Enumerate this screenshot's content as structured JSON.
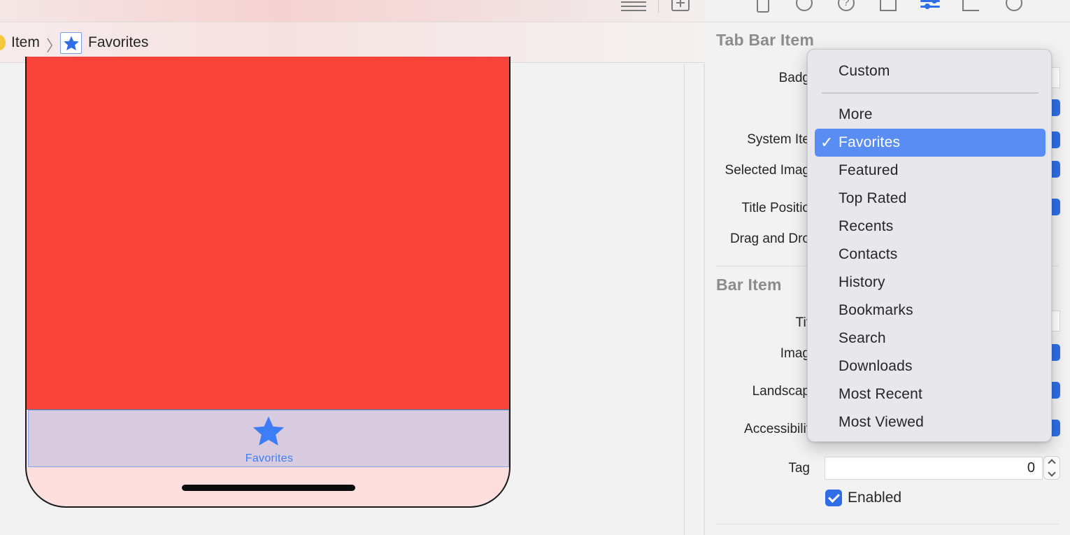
{
  "breadcrumb": {
    "item_label": "Item",
    "separator": "〉",
    "current_label": "Favorites",
    "current_icon": "star-icon"
  },
  "canvas": {
    "tab_bar_label": "Favorites",
    "tab_icon": "star-icon",
    "colors": {
      "view_background": "#f8433a",
      "tab_bar": "#d8cbe0",
      "accent": "#3d7ef6"
    }
  },
  "inspector": {
    "sections": {
      "tab_bar_item": "Tab Bar Item",
      "bar_item": "Bar Item"
    },
    "labels": {
      "badge": "Badg",
      "system_item": "System Ite",
      "selected_image": "Selected Imag",
      "title_position": "Title Positio",
      "drag_and_drop": "Drag and Dro",
      "title": "Tit",
      "image": "Imag",
      "landscape": "Landscap",
      "accessibility": "Accessibilit",
      "tag": "Tag"
    },
    "tag_value": "0",
    "enabled_label": "Enabled",
    "enabled_checked": true,
    "accent_color": "#2f6ee6"
  },
  "menu": {
    "header_item": "Custom",
    "check_mark": "✓",
    "selected": "Favorites",
    "items": [
      "More",
      "Favorites",
      "Featured",
      "Top Rated",
      "Recents",
      "Contacts",
      "History",
      "Bookmarks",
      "Search",
      "Downloads",
      "Most Recent",
      "Most Viewed"
    ],
    "highlight_color": "#5a8df3"
  }
}
